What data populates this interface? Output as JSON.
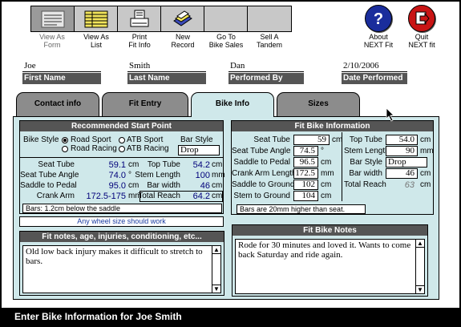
{
  "toolbar": {
    "buttons": [
      {
        "label": "View As\nForm",
        "icon": "form-view-icon"
      },
      {
        "label": "View As\nList",
        "icon": "list-view-icon"
      },
      {
        "label": "Print\nFit Info",
        "icon": "printer-icon"
      },
      {
        "label": "New\nRecord",
        "icon": "new-record-icon"
      },
      {
        "label": "Go To\nBike Sales",
        "icon": "bike-sales-icon"
      },
      {
        "label": "Sell A\nTandem",
        "icon": "tandem-icon"
      }
    ],
    "about_label": "About\nNEXT Fit",
    "quit_label": "Quit\nNEXT fit",
    "about_color": "#1a2d9c",
    "quit_color": "#c81414"
  },
  "record": {
    "first_name": "Joe",
    "first_name_label": "First Name",
    "last_name": "Smith",
    "last_name_label": "Last Name",
    "performed_by": "Dan",
    "performed_by_label": "Performed By",
    "date": "2/10/2006",
    "date_label": "Date Performed"
  },
  "tabs": [
    "Contact info",
    "Fit Entry",
    "Bike Info",
    "Sizes"
  ],
  "active_tab": "Bike Info",
  "recommended": {
    "title": "Recommended Start Point",
    "bike_style_label": "Bike Style",
    "bar_style_label": "Bar Style",
    "bar_style_value": "Drop",
    "radios": [
      {
        "label": "Road Sport",
        "selected": true
      },
      {
        "label": "ATB Sport",
        "selected": false
      },
      {
        "label": "Road Racing",
        "selected": false
      },
      {
        "label": "ATB Racing",
        "selected": false
      }
    ],
    "left": [
      {
        "label": "Seat Tube",
        "value": "59.1",
        "unit": "cm"
      },
      {
        "label": "Seat Tube Angle",
        "value": "74.0",
        "unit": "°"
      },
      {
        "label": "Saddle to Pedal",
        "value": "95.0",
        "unit": "cm"
      },
      {
        "label": "Crank Arm",
        "value": "172.5-175",
        "unit": "mm"
      }
    ],
    "right": [
      {
        "label": "Top Tube",
        "value": "54.2",
        "unit": "cm"
      },
      {
        "label": "Stem Length",
        "value": "100",
        "unit": "mm"
      },
      {
        "label": "Bar width",
        "value": "46",
        "unit": "cm"
      },
      {
        "label": "Total Reach",
        "value": "64.2",
        "unit": "cm"
      }
    ],
    "bars_note": "Bars: 1.2cm  below the saddle",
    "wheel_note": "Any wheel size should work"
  },
  "fit_bike_info": {
    "title": "Fit Bike Information",
    "left": [
      {
        "label": "Seat Tube",
        "value": "59",
        "unit": "cm"
      },
      {
        "label": "Seat Tube Angle",
        "value": "74.5",
        "unit": "°"
      },
      {
        "label": "Saddle to Pedal",
        "value": "96.5",
        "unit": "cm"
      },
      {
        "label": "Crank Arm Length",
        "value": "172.5",
        "unit": "mm"
      },
      {
        "label": "Saddle to Ground",
        "value": "102",
        "unit": "cm"
      },
      {
        "label": "Stem to Ground",
        "value": "104",
        "unit": "cm"
      }
    ],
    "right": [
      {
        "label": "Top Tube",
        "value": "54.0",
        "unit": "cm"
      },
      {
        "label": "Stem Length",
        "value": "90",
        "unit": "mm"
      },
      {
        "label": "Bar Style",
        "value": "Drop",
        "unit": ""
      },
      {
        "label": "Bar width",
        "value": "46",
        "unit": "cm"
      },
      {
        "label": "Total Reach",
        "value": "63",
        "unit": "cm"
      }
    ],
    "bars_note": "Bars are 20mm higher than seat."
  },
  "fit_notes": {
    "title": "Fit notes, age, injuries, conditioning, etc...",
    "text": "Old low back injury makes it difficult to stretch to bars."
  },
  "bike_notes": {
    "title": "Fit Bike Notes",
    "text": "Rode for 30 minutes and loved it.  Wants to come back Saturday and ride again."
  },
  "status": "Enter Bike Information for Joe Smith"
}
